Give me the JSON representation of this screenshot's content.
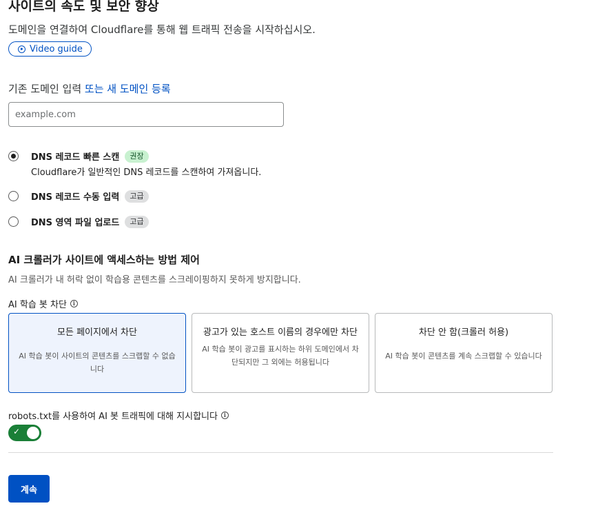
{
  "header": {
    "title": "사이트의 속도 및 보안 향상",
    "subtitle": "도메인을 연결하여 Cloudflare를 통해 웹 트래픽 전송을 시작하십시오.",
    "video_guide_label": "Video guide"
  },
  "domain": {
    "label": "기존 도메인 입력",
    "register_link": "또는 새 도메인 등록",
    "input_value": "",
    "placeholder": "example.com"
  },
  "dns_options": [
    {
      "label": "DNS 레코드 빠른 스캔",
      "badge": "권장",
      "description": "Cloudflare가 일반적인 DNS 레코드를 스캔하여 가져옵니다.",
      "selected": true
    },
    {
      "label": "DNS 레코드 수동 입력",
      "badge": "고급",
      "selected": false
    },
    {
      "label": "DNS 영역 파일 업로드",
      "badge": "고급",
      "selected": false
    }
  ],
  "ai_section": {
    "title": "AI 크롤러가 사이트에 액세스하는 방법 제어",
    "subtitle": "AI 크롤러가 내 허락 없이 학습용 콘텐츠를 스크레이핑하지 못하게 방지합니다.",
    "bot_block_label": "AI 학습 봇 차단",
    "cards": [
      {
        "title": "모든 페이지에서 차단",
        "description": "AI 학습 봇이 사이트의 콘텐츠를 스크랩할 수 없습니다",
        "selected": true
      },
      {
        "title": "광고가 있는 호스트 이름의 경우에만 차단",
        "description": "AI 학습 봇이 광고를 표시하는 하위 도메인에서 차단되지만 그 외에는 허용됩니다",
        "selected": false
      },
      {
        "title": "차단 안 함(크롤러 허용)",
        "description": "AI 학습 봇이 콘텐츠를 계속 스크랩할 수 있습니다",
        "selected": false
      }
    ],
    "robots_label": "robots.txt를 사용하여 AI 봇 트래픽에 대해 지시합니다",
    "robots_enabled": true
  },
  "footer": {
    "continue_label": "계속"
  },
  "icons": {
    "play": "play-circle-icon",
    "info": "info-icon",
    "check": "check-icon"
  },
  "colors": {
    "accent": "#0051c3",
    "toggle_on": "#1a7f37",
    "badge_recommended_bg": "#c8f1d0",
    "badge_advanced_bg": "#dedfe0",
    "card_selected_bg": "#eef3fd"
  }
}
